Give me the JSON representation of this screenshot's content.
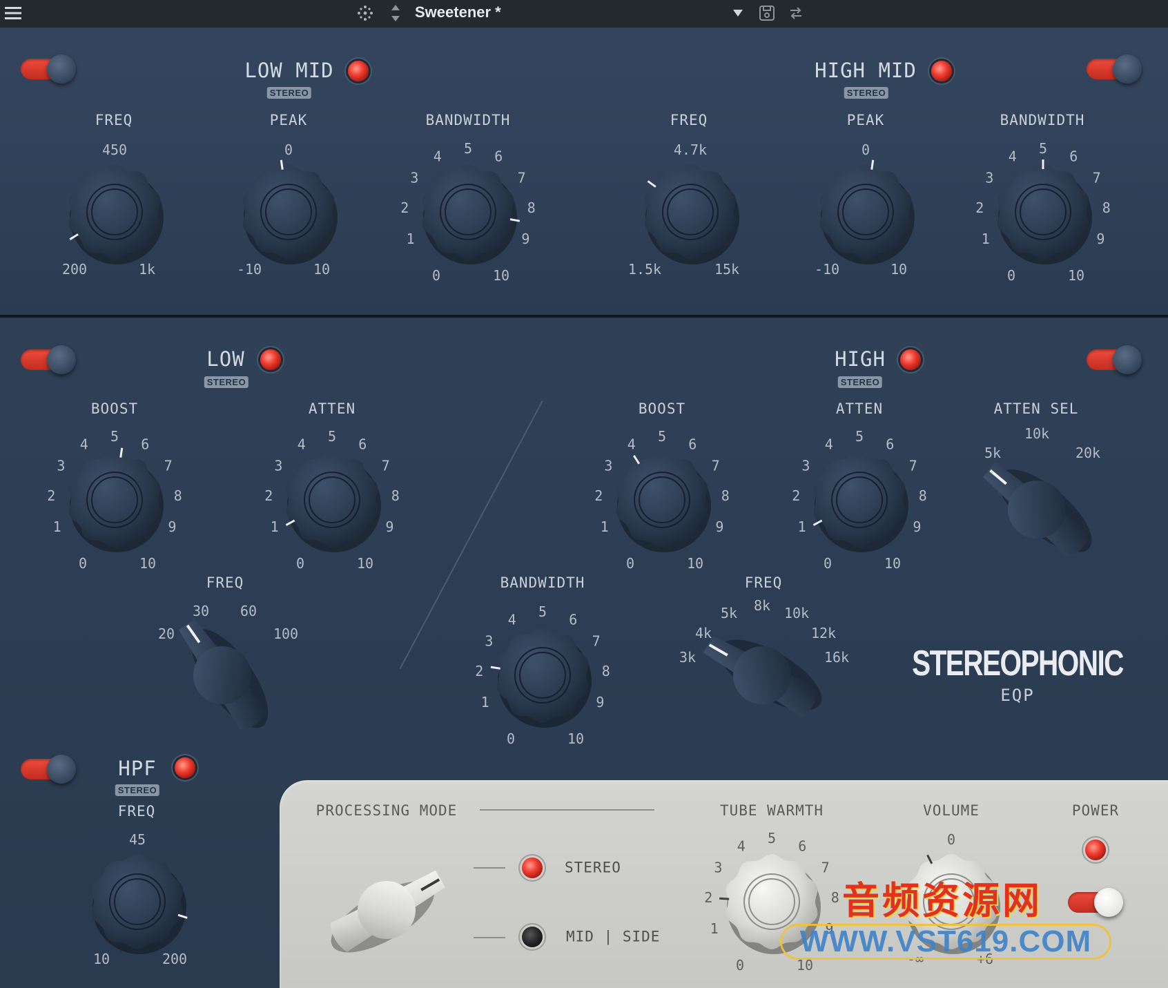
{
  "topbar": {
    "preset_name": "Sweetener *"
  },
  "top_section": {
    "low_mid": {
      "title": "LOW MID",
      "badge": "STEREO",
      "freq": {
        "label": "FREQ",
        "value": "450",
        "min": "200",
        "max": "1k"
      },
      "peak": {
        "label": "PEAK",
        "value": "0",
        "min": "-10",
        "max": "10"
      },
      "bandwidth": {
        "label": "BANDWIDTH",
        "min": "0",
        "max": "10",
        "ticks": [
          "1",
          "2",
          "3",
          "4",
          "5",
          "6",
          "7",
          "8",
          "9"
        ]
      }
    },
    "high_mid": {
      "title": "HIGH MID",
      "badge": "STEREO",
      "freq": {
        "label": "FREQ",
        "value": "4.7k",
        "min": "1.5k",
        "max": "15k"
      },
      "peak": {
        "label": "PEAK",
        "value": "0",
        "min": "-10",
        "max": "10"
      },
      "bandwidth": {
        "label": "BANDWIDTH",
        "min": "0",
        "max": "10",
        "ticks": [
          "1",
          "2",
          "3",
          "4",
          "5",
          "6",
          "7",
          "8",
          "9"
        ]
      }
    }
  },
  "bottom_section": {
    "low": {
      "title": "LOW",
      "badge": "STEREO",
      "boost": {
        "label": "BOOST",
        "min": "0",
        "max": "10",
        "ticks": [
          "1",
          "2",
          "3",
          "4",
          "5",
          "6",
          "7",
          "8",
          "9"
        ]
      },
      "atten": {
        "label": "ATTEN",
        "min": "0",
        "max": "10",
        "ticks": [
          "1",
          "2",
          "3",
          "4",
          "5",
          "6",
          "7",
          "8",
          "9"
        ]
      },
      "freq": {
        "label": "FREQ",
        "options": [
          "20",
          "30",
          "60",
          "100"
        ],
        "selected": "100"
      }
    },
    "high": {
      "title": "HIGH",
      "badge": "STEREO",
      "boost": {
        "label": "BOOST",
        "min": "0",
        "max": "10",
        "ticks": [
          "1",
          "2",
          "3",
          "4",
          "5",
          "6",
          "7",
          "8",
          "9"
        ]
      },
      "atten": {
        "label": "ATTEN",
        "min": "0",
        "max": "10",
        "ticks": [
          "1",
          "2",
          "3",
          "4",
          "5",
          "6",
          "7",
          "8",
          "9"
        ]
      },
      "atten_sel": {
        "label": "ATTEN SEL",
        "options": [
          "5k",
          "10k",
          "20k"
        ],
        "selected": "5k"
      },
      "bandwidth": {
        "label": "BANDWIDTH",
        "min": "0",
        "max": "10",
        "ticks": [
          "1",
          "2",
          "3",
          "4",
          "5",
          "6",
          "7",
          "8",
          "9"
        ]
      },
      "freq": {
        "label": "FREQ",
        "options": [
          "3k",
          "4k",
          "5k",
          "8k",
          "10k",
          "12k",
          "16k"
        ],
        "selected": "4k"
      }
    },
    "hpf": {
      "title": "HPF",
      "badge": "STEREO",
      "freq": {
        "label": "FREQ",
        "value": "45",
        "min": "10",
        "max": "200"
      }
    },
    "logo": {
      "line1": "STEREOPHONIC",
      "line2": "EQP"
    }
  },
  "output_section": {
    "processing_mode": {
      "label": "PROCESSING MODE",
      "options": [
        "STEREO",
        "MID | SIDE"
      ],
      "selected": "STEREO"
    },
    "tube_warmth": {
      "label": "TUBE WARMTH",
      "min": "0",
      "max": "10",
      "ticks": [
        "1",
        "2",
        "3",
        "4",
        "5",
        "6",
        "7",
        "8",
        "9"
      ]
    },
    "volume": {
      "label": "VOLUME",
      "value": "0",
      "min": "-∞",
      "max": "+6"
    },
    "power": {
      "label": "POWER"
    }
  },
  "watermark": {
    "cn": "音频资源网",
    "url": "WWW.VST619.COM"
  },
  "knob_positions": {
    "low_mid_freq": 0.05,
    "low_mid_peak": 0.47,
    "low_mid_bandwidth": 0.87,
    "high_mid_freq": 0.3,
    "high_mid_peak": 0.53,
    "high_mid_bandwidth": 0.5,
    "low_boost": 0.53,
    "low_atten": 0.06,
    "high_boost": 0.38,
    "high_atten": 0.06,
    "high_bandwidth": 0.2,
    "hpf_freq": 0.9,
    "tube_warmth": 0.18,
    "volume": 0.4
  }
}
